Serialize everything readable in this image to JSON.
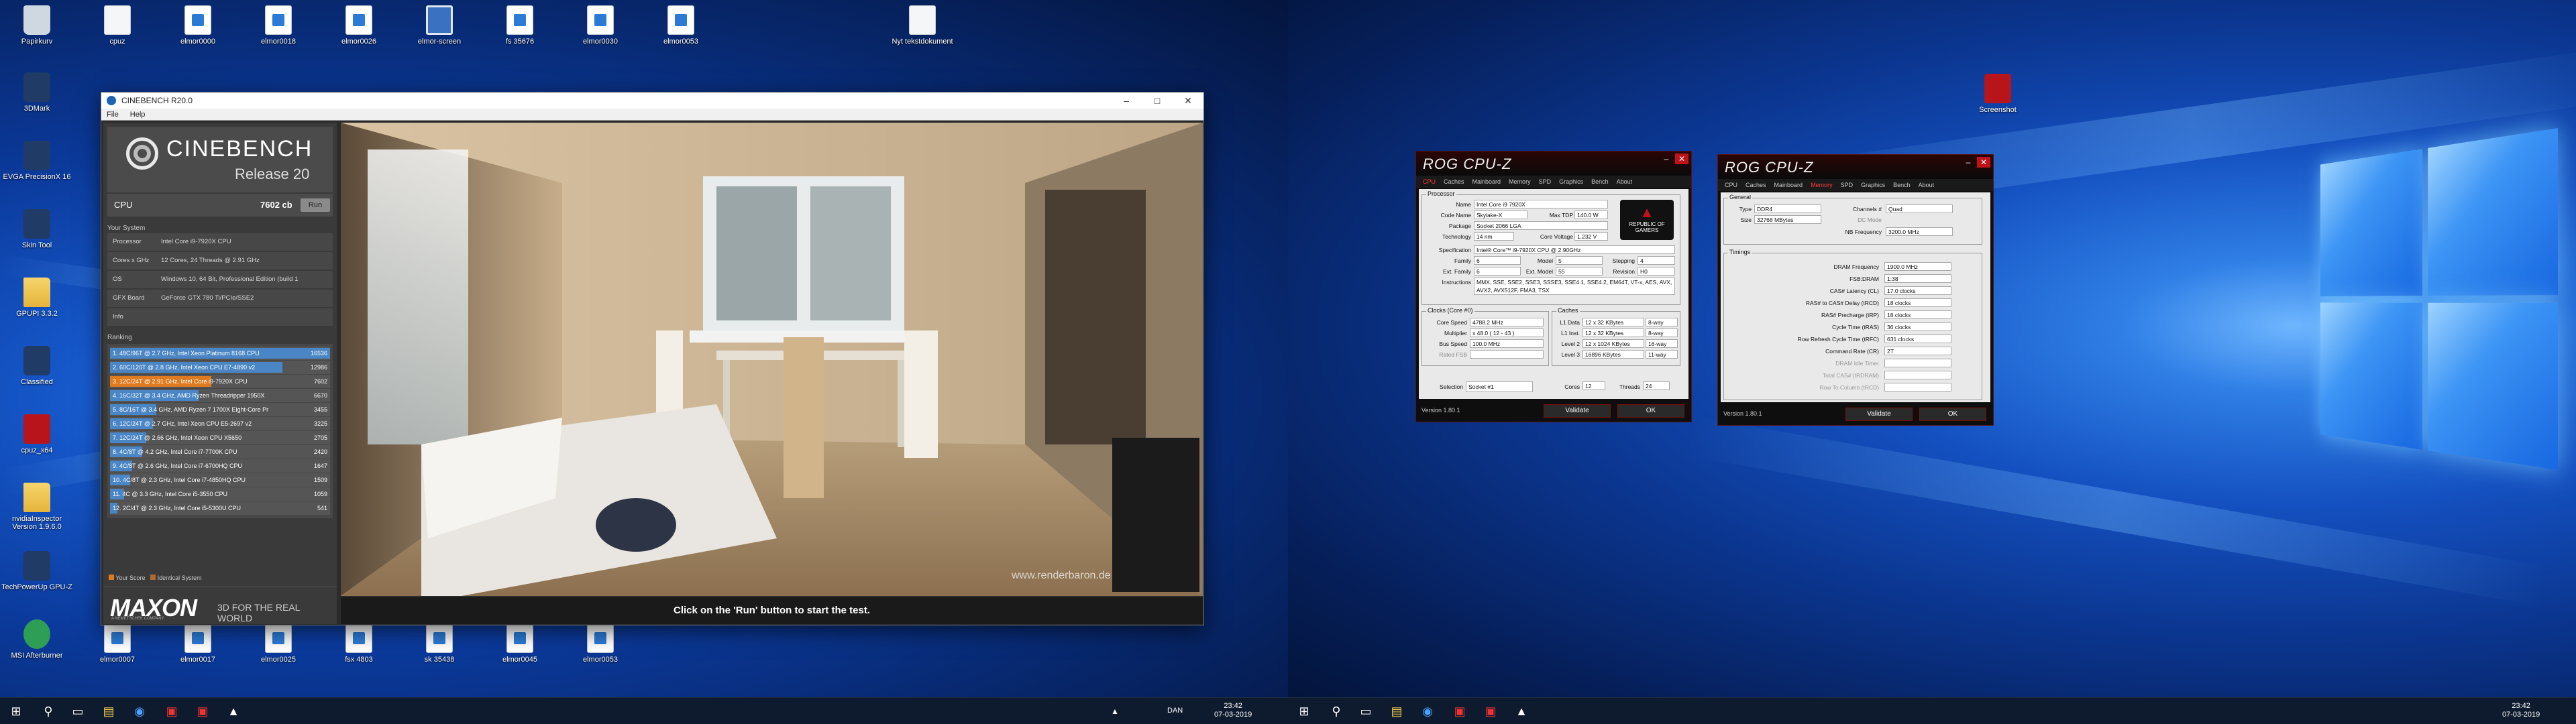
{
  "left_desktop": {
    "icons_top": [
      {
        "label": "Papirkurv",
        "icon": "recycle-bin"
      },
      {
        "label": "cpuz",
        "icon": "file"
      },
      {
        "label": "elmor0000",
        "icon": "document"
      },
      {
        "label": "elmor0018",
        "icon": "document"
      },
      {
        "label": "elmor0026",
        "icon": "document"
      },
      {
        "label": "elmor-screen",
        "icon": "screen"
      },
      {
        "label": "fs 35676",
        "icon": "document"
      },
      {
        "label": "elmor0030",
        "icon": "document"
      },
      {
        "label": "elmor0053",
        "icon": "document"
      },
      {
        "label": "Nyt tekstdokument",
        "icon": "file"
      }
    ],
    "icons_left": [
      {
        "label": "3DMark",
        "icon": "app"
      },
      {
        "label": "EVGA PrecisionX 16",
        "icon": "app"
      },
      {
        "label": "Skin Tool",
        "icon": "app"
      },
      {
        "label": "GPUPI 3.3.2",
        "icon": "folder"
      },
      {
        "label": "Classified",
        "icon": "app"
      },
      {
        "label": "cpuz_x64",
        "icon": "red"
      },
      {
        "label": "nvidiaInspector Version 1.9.6.0",
        "icon": "folder"
      },
      {
        "label": "TechPowerUp GPU-Z",
        "icon": "app"
      },
      {
        "label": "MSI Afterburner",
        "icon": "green"
      }
    ],
    "icons_bottom": [
      {
        "label": "elmor0007",
        "icon": "document"
      },
      {
        "label": "elmor0017",
        "icon": "document"
      },
      {
        "label": "elmor0025",
        "icon": "document"
      },
      {
        "label": "fsx 4803",
        "icon": "document"
      },
      {
        "label": "sk 35438",
        "icon": "document"
      },
      {
        "label": "elmor0045",
        "icon": "document"
      },
      {
        "label": "elmor0053",
        "icon": "document"
      }
    ],
    "taskbar": {
      "lang": "DAN",
      "time": "23:42",
      "date": "07-03-2019"
    }
  },
  "cinebench": {
    "title": "CINEBENCH R20.0",
    "menu": [
      "File",
      "Help"
    ],
    "logo_name": "CINEBENCH",
    "logo_release": "Release 20",
    "cpu_label": "CPU",
    "cpu_score": "7602 cb",
    "run_label": "Run",
    "system_header": "Your System",
    "system": [
      {
        "k": "Processor",
        "v": "Intel Core i9-7920X CPU"
      },
      {
        "k": "Cores x GHz",
        "v": "12 Cores, 24 Threads @ 2.91 GHz"
      },
      {
        "k": "OS",
        "v": "Windows 10, 64 Bit, Professional Edition (build 1"
      },
      {
        "k": "GFX Board",
        "v": "GeForce GTX 780 Ti/PCIe/SSE2"
      },
      {
        "k": "Info",
        "v": ""
      }
    ],
    "ranking_header": "Ranking",
    "ranking": [
      {
        "t": "1. 48C/96T @ 2.7 GHz, Intel Xeon Platinum 8168 CPU",
        "s": "16536",
        "pct": 1.0,
        "current": false
      },
      {
        "t": "2. 60C/120T @ 2.8 GHz, Intel Xeon CPU E7-4890 v2",
        "s": "12986",
        "pct": 0.785,
        "current": false
      },
      {
        "t": "3. 12C/24T @ 2.91 GHz, Intel Core i9-7920X CPU",
        "s": "7602",
        "pct": 0.46,
        "current": true
      },
      {
        "t": "4. 16C/32T @ 3.4 GHz, AMD Ryzen Threadripper 1950X",
        "s": "6670",
        "pct": 0.403,
        "current": false
      },
      {
        "t": "5. 8C/16T @ 3.4 GHz, AMD Ryzen 7 1700X Eight-Core Pr",
        "s": "3455",
        "pct": 0.209,
        "current": false
      },
      {
        "t": "6. 12C/24T @ 2.7 GHz, Intel Xeon CPU E5-2697 v2",
        "s": "3225",
        "pct": 0.195,
        "current": false
      },
      {
        "t": "7. 12C/24T @ 2.66 GHz, Intel Xeon CPU X5650",
        "s": "2705",
        "pct": 0.164,
        "current": false
      },
      {
        "t": "8. 4C/8T @ 4.2 GHz, Intel Core i7-7700K CPU",
        "s": "2420",
        "pct": 0.146,
        "current": false
      },
      {
        "t": "9. 4C/8T @ 2.6 GHz, Intel Core i7-6700HQ CPU",
        "s": "1647",
        "pct": 0.1,
        "current": false
      },
      {
        "t": "10. 4C/8T @ 2.3 GHz, Intel Core i7-4850HQ CPU",
        "s": "1509",
        "pct": 0.091,
        "current": false
      },
      {
        "t": "11. 4C @ 3.3 GHz, Intel Core i5-3550 CPU",
        "s": "1059",
        "pct": 0.064,
        "current": false
      },
      {
        "t": "12. 2C/4T @ 2.3 GHz, Intel Core i5-5300U CPU",
        "s": "541",
        "pct": 0.033,
        "current": false
      }
    ],
    "legend_your": "Your Score",
    "legend_identical": "Identical System",
    "maxon": "MAXON",
    "maxon_sub": "A NEMETSCHEK COMPANY",
    "tagline": "3D FOR THE REAL WORLD",
    "watermark": "www.renderbaron.de",
    "status": "Click on the 'Run' button to start the test."
  },
  "cpuz1": {
    "brand": "ROG CPU-Z",
    "tabs": [
      "CPU",
      "Caches",
      "Mainboard",
      "Memory",
      "SPD",
      "Graphics",
      "Bench",
      "About"
    ],
    "active": "CPU",
    "proc_title": "Processor",
    "name_l": "Name",
    "name": "Intel Core i9 7920X",
    "code_l": "Code Name",
    "code": "Skylake-X",
    "tdp_l": "Max TDP",
    "tdp": "140.0 W",
    "pkg_l": "Package",
    "pkg": "Socket 2066 LGA",
    "tech_l": "Technology",
    "tech": "14 nm",
    "volt_l": "Core Voltage",
    "volt": "1.232 V",
    "spec_l": "Specification",
    "spec": "Intel® Core™ i9-7920X CPU @ 2.90GHz",
    "fam_l": "Family",
    "fam": "6",
    "model_l": "Model",
    "model": "5",
    "step_l": "Stepping",
    "step": "4",
    "efam_l": "Ext. Family",
    "efam": "6",
    "emodel_l": "Ext. Model",
    "emodel": "55",
    "rev_l": "Revision",
    "rev": "H0",
    "instr_l": "Instructions",
    "instr": "MMX, SSE, SSE2, SSE3, SSSE3, SSE4.1, SSE4.2, EM64T, VT-x, AES, AVX, AVX2, AVX512F, FMA3, TSX",
    "clocks_title": "Clocks (Core #0)",
    "cs_l": "Core Speed",
    "cs": "4788.2 MHz",
    "mul_l": "Multiplier",
    "mul": "x 48.0 ( 12 - 43 )",
    "bus_l": "Bus Speed",
    "bus": "100.0 MHz",
    "fsb_l": "Rated FSB",
    "fsb": "",
    "caches_title": "Caches",
    "l1d_l": "L1 Data",
    "l1d": "12 x 32 KBytes",
    "l1d_w": "8-way",
    "l1i_l": "L1 Inst.",
    "l1i": "12 x 32 KBytes",
    "l1i_w": "8-way",
    "l2_l": "Level 2",
    "l2": "12 x 1024 KBytes",
    "l2_w": "16-way",
    "l3_l": "Level 3",
    "l3": "16896 KBytes",
    "l3_w": "11-way",
    "sel_l": "Selection",
    "sel": "Socket #1",
    "cores_l": "Cores",
    "cores": "12",
    "thr_l": "Threads",
    "thr": "24",
    "logo_text": "REPUBLIC OF GAMERS",
    "version": "Version 1.80.1",
    "validate": "Validate",
    "ok": "OK"
  },
  "cpuz2": {
    "brand": "ROG CPU-Z",
    "tabs": [
      "CPU",
      "Caches",
      "Mainboard",
      "Memory",
      "SPD",
      "Graphics",
      "Bench",
      "About"
    ],
    "active": "Memory",
    "gen_title": "General",
    "type_l": "Type",
    "type": "DDR4",
    "ch_l": "Channels #",
    "ch": "Quad",
    "size_l": "Size",
    "size": "32768 MBytes",
    "dc_l": "DC Mode",
    "dc": "",
    "nb_l": "NB Frequency",
    "nb": "3200.0 MHz",
    "tim_title": "Timings",
    "timings": [
      {
        "l": "DRAM Frequency",
        "v": "1900.0 MHz"
      },
      {
        "l": "FSB:DRAM",
        "v": "1:38"
      },
      {
        "l": "CAS# Latency (CL)",
        "v": "17.0 clocks"
      },
      {
        "l": "RAS# to CAS# Delay (tRCD)",
        "v": "18 clocks"
      },
      {
        "l": "RAS# Precharge (tRP)",
        "v": "18 clocks"
      },
      {
        "l": "Cycle Time (tRAS)",
        "v": "36 clocks"
      },
      {
        "l": "Row Refresh Cycle Time (tRFC)",
        "v": "631 clocks"
      },
      {
        "l": "Command Rate (CR)",
        "v": "2T"
      },
      {
        "l": "DRAM Idle Timer",
        "v": ""
      },
      {
        "l": "Total CAS# (tRDRAM)",
        "v": ""
      },
      {
        "l": "Row To Column (tRCD)",
        "v": ""
      }
    ],
    "version": "Version 1.80.1",
    "validate": "Validate",
    "ok": "OK"
  },
  "right_desktop": {
    "icon": {
      "label": "Screenshot",
      "icon": "red"
    },
    "taskbar": {
      "time": "23:42",
      "date": "07-03-2019"
    }
  }
}
